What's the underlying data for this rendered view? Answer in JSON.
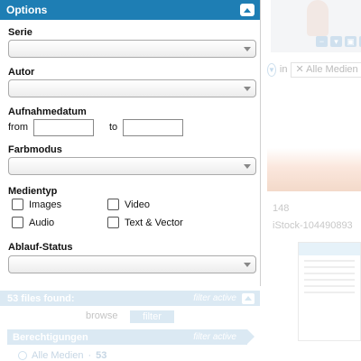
{
  "background": {
    "filter_in": "in",
    "filter_chip": "Alle Medien",
    "result_number": "148",
    "result_filename": "iStock-104490893"
  },
  "options": {
    "title": "Options",
    "fields": {
      "serie": {
        "label": "Serie",
        "value": ""
      },
      "autor": {
        "label": "Autor",
        "value": ""
      },
      "aufnahmedatum": {
        "label": "Aufnahmedatum",
        "from_label": "from",
        "to_label": "to",
        "from_value": "",
        "to_value": ""
      },
      "farbmodus": {
        "label": "Farbmodus",
        "value": ""
      },
      "medientyp": {
        "label": "Medientyp",
        "options": [
          {
            "label": "Images",
            "checked": false
          },
          {
            "label": "Video",
            "checked": false
          },
          {
            "label": "Audio",
            "checked": false
          },
          {
            "label": "Text & Vector",
            "checked": false
          }
        ]
      },
      "ablauf_status": {
        "label": "Ablauf-Status",
        "value": ""
      }
    }
  },
  "results": {
    "files_found": "53 files found:",
    "filter_active": "filter active",
    "tabs": {
      "browse": "browse",
      "filter": "filter"
    },
    "permissions": {
      "title": "Berechtigungen",
      "filter_active": "filter active"
    },
    "media": {
      "label": "Alle Medien",
      "separator": "·",
      "count": "53"
    }
  },
  "colors": {
    "accent": "#1e7eb4",
    "faded_accent": "#dbe9f3"
  }
}
